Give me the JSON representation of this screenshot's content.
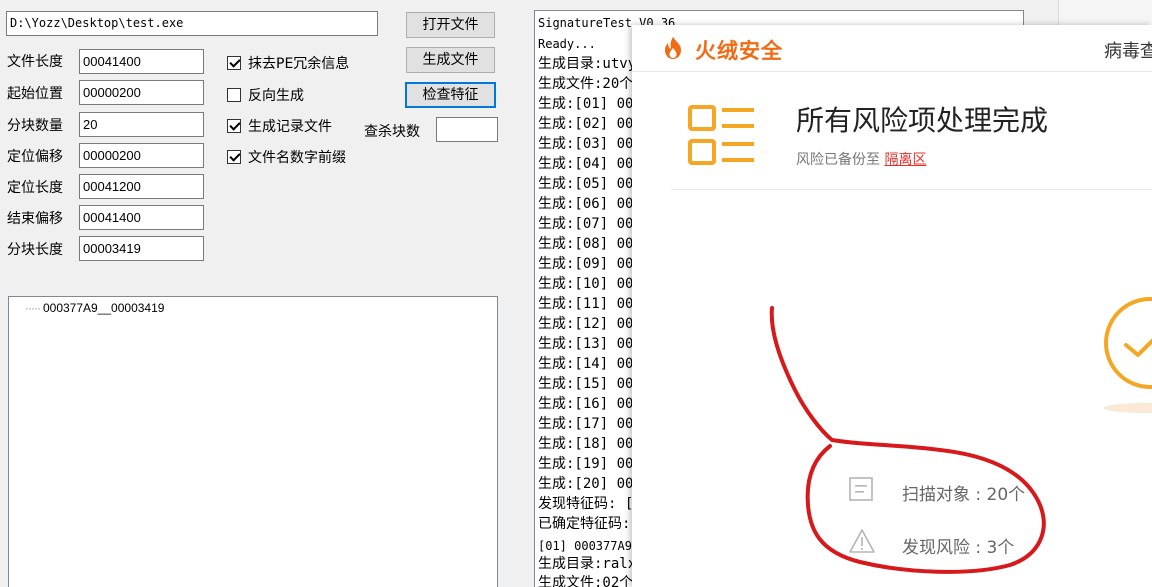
{
  "tool": {
    "path": "D:\\Yozz\\Desktop\\test.exe",
    "buttons": {
      "open": "打开文件",
      "generate": "生成文件",
      "check": "检查特征"
    },
    "fields": [
      {
        "label": "文件长度",
        "value": "00041400"
      },
      {
        "label": "起始位置",
        "value": "00000200"
      },
      {
        "label": "分块数量",
        "value": "20"
      },
      {
        "label": "定位偏移",
        "value": "00000200"
      },
      {
        "label": "定位长度",
        "value": "00041200"
      },
      {
        "label": "结束偏移",
        "value": "00041400"
      },
      {
        "label": "分块长度",
        "value": "00003419"
      }
    ],
    "checks": [
      {
        "label": "抹去PE冗余信息",
        "checked": true
      },
      {
        "label": "反向生成",
        "checked": false
      },
      {
        "label": "生成记录文件",
        "checked": true
      },
      {
        "label": "文件名数字前缀",
        "checked": true
      }
    ],
    "kill_label": "查杀块数",
    "tree_item": "000377A9__00003419"
  },
  "log": [
    "SignatureTest V0.36",
    "Ready...",
    "生成目录:utvy",
    "生成文件:20个",
    "生成:[01] 000",
    "生成:[02] 000",
    "生成:[03] 000",
    "生成:[04] 000",
    "生成:[05] 000",
    "生成:[06] 000",
    "生成:[07] 000",
    "生成:[08] 000",
    "生成:[09] 000",
    "生成:[10] 000",
    "生成:[11] 000",
    "生成:[12] 000",
    "生成:[13] 000",
    "生成:[14] 000",
    "生成:[15] 000",
    "生成:[16] 000",
    "生成:[17] 000",
    "生成:[18] 000",
    "生成:[19] 000",
    "生成:[20] 000",
    "发现特征码: [",
    "已确定特征码:",
    "[01] 000377A9",
    "生成目录:ralx",
    "生成文件:02个"
  ],
  "popup": {
    "brand": "火绒安全",
    "header_right": "病毒查",
    "title": "所有风险项处理完成",
    "subtitle": "风险已备份至 ",
    "quarantine_link": "隔离区",
    "scan_stat": "扫描对象 : 20个",
    "risk_stat": "发现风险 : 3个",
    "colors": {
      "brand": "#f06b14",
      "accent": "#f5a623",
      "link": "#e5322d",
      "scribble": "#d7191c"
    }
  }
}
